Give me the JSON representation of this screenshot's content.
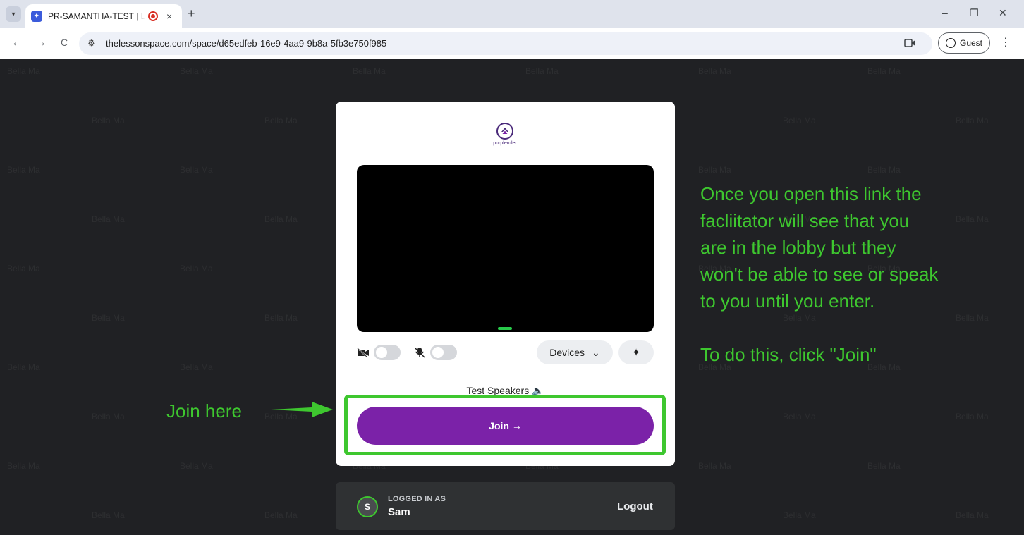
{
  "browser": {
    "tab_title": "PR-SAMANTHA-TEST | Lessonspace",
    "tab_close": "×",
    "new_tab": "+",
    "url": "thelessonspace.com/space/d65edfeb-16e9-4aa9-9b8a-5fb3e750f985",
    "profile_label": "Guest",
    "window_minimize": "–",
    "window_restore": "❐",
    "window_close": "✕",
    "back": "←",
    "forward": "→",
    "reload": "C",
    "site_info": "⚙",
    "menu": "⋮"
  },
  "watermark": "Bella Ma",
  "logo": {
    "text": "purpleruler"
  },
  "controls": {
    "devices_label": "Devices",
    "devices_chevron": "⌄",
    "effects_icon": "✦",
    "camera_icon": "📷",
    "mic_icon": "🎙"
  },
  "test_speakers": "Test Speakers 🔈",
  "join_label": "Join →",
  "login": {
    "label": "LOGGED IN AS",
    "name": "Sam",
    "avatar_initial": "S",
    "logout_label": "Logout"
  },
  "annotations": {
    "join_here": "Join here",
    "instructions": [
      "Once you open this link the",
      "facliitator will see that you",
      "are in the lobby but they",
      "won't be able to see or speak",
      "to you until you enter."
    ],
    "instruction_cta": "To do this, click \"Join\""
  },
  "colors": {
    "page_bg": "#202124",
    "join_button": "#7b22a8",
    "annotation_green": "#3ec72f"
  }
}
